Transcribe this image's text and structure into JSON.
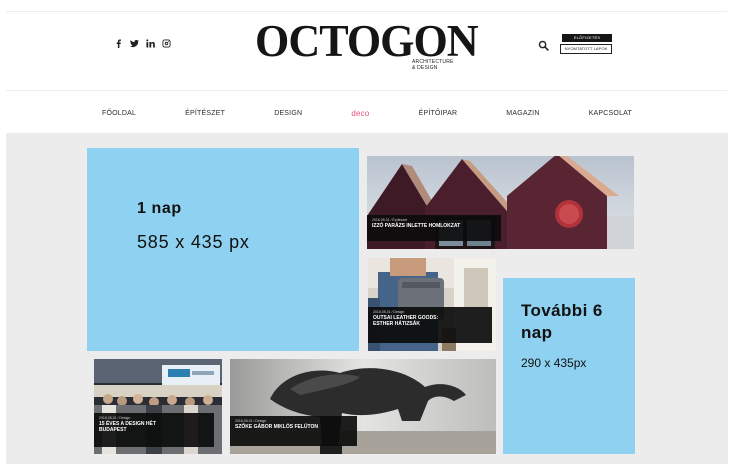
{
  "header": {
    "social": [
      {
        "icon": "facebook-icon"
      },
      {
        "icon": "twitter-icon"
      },
      {
        "icon": "linkedin-icon"
      },
      {
        "icon": "instagram-icon"
      }
    ],
    "logo": {
      "text": "OCTOGON",
      "sub_line1": "ARCHITECTURE",
      "sub_line2": "& DESIGN"
    },
    "search_icon": "search-icon",
    "buttons": {
      "subscribe": "ELŐFIZETÉS",
      "printed": "NYOMTATOTT LAPOK"
    }
  },
  "nav": {
    "items": [
      {
        "label": "Főoldal",
        "active": false
      },
      {
        "label": "Építészet",
        "active": false
      },
      {
        "label": "Design",
        "active": false
      },
      {
        "label": "deco",
        "active": true
      },
      {
        "label": "Építőipar",
        "active": false
      },
      {
        "label": "Magazin",
        "active": false
      },
      {
        "label": "Kapcsolat",
        "active": false
      }
    ]
  },
  "ads": {
    "main": {
      "title": "1 nap",
      "size": "585 x 435 px"
    },
    "side": {
      "title": "További 6 nap",
      "size": "290 x 435px"
    }
  },
  "cards": {
    "house": {
      "meta": "2016.05.31 / Építészet",
      "title": "IZZÓ PARÁZS INLETTE HOMLOKZAT"
    },
    "bag": {
      "meta": "2016.05.31 / Design",
      "title_line1": "OUTSAI LEATHER GOODS:",
      "title_line2": "ESTHER HÁTIZSÁK"
    },
    "event": {
      "meta": "2016.05.31 / Design",
      "title_line1": "15 ÉVES A DESIGN HÉT",
      "title_line2": "BUDAPEST"
    },
    "sculpt": {
      "meta": "2016.05.31 / Design",
      "title": "SZŐKE GÁBOR MIKLÓS FELÜTON"
    }
  },
  "colors": {
    "ad_blue": "#8fd1f0",
    "active_nav": "#e8507a",
    "content_bg": "#ececec"
  }
}
